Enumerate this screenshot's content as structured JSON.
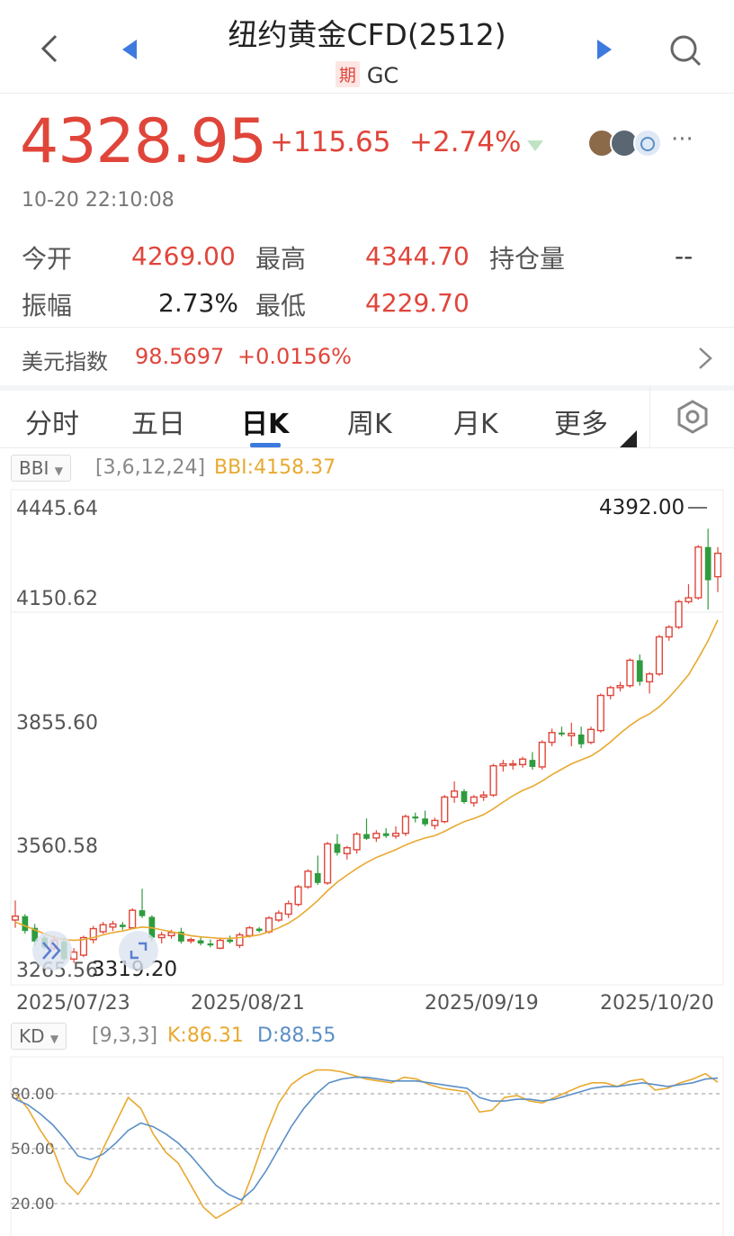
{
  "header": {
    "title": "纽约黄金CFD(2512)",
    "badge": "期",
    "code": "GC"
  },
  "quote": {
    "price": "4328.95",
    "change": "+115.65",
    "change_pct": "+2.74%",
    "timestamp": "10-20 22:10:08",
    "stats": {
      "open_label": "今开",
      "open": "4269.00",
      "high_label": "最高",
      "high": "4344.70",
      "oi_label": "持仓量",
      "oi": "--",
      "amp_label": "振幅",
      "amp": "2.73%",
      "low_label": "最低",
      "low": "4229.70"
    },
    "more_dots": "···"
  },
  "usd_index": {
    "label": "美元指数",
    "value": "98.5697",
    "change": "+0.0156%"
  },
  "tabs": [
    "分时",
    "五日",
    "日K",
    "周K",
    "月K",
    "更多"
  ],
  "active_tab": "日K",
  "colors": {
    "up": "#e0453a",
    "down": "#2e9b3e",
    "bbi": "#e8a930",
    "d_line": "#5b8fc7",
    "accent": "#3d7ae0"
  },
  "main_indicator": {
    "name": "BBI",
    "params": "[3,6,12,24]",
    "value_text": "BBI:4158.37"
  },
  "kd_indicator": {
    "name": "KD",
    "params": "[9,3,3]",
    "k_text": "K:86.31",
    "d_text": "D:88.55"
  },
  "chart_data": [
    {
      "type": "candlestick",
      "y_ticks": [
        "4445.64",
        "4150.62",
        "3855.60",
        "3560.58",
        "3265.56"
      ],
      "ylim": [
        3265.56,
        4445.64
      ],
      "x_ticks": [
        "2025/07/23",
        "2025/08/21",
        "2025/09/19",
        "2025/10/20"
      ],
      "high_marker": "4392.00",
      "low_marker": "3319.20",
      "candles": [
        {
          "o": 3390,
          "h": 3440,
          "l": 3370,
          "c": 3400
        },
        {
          "o": 3400,
          "h": 3405,
          "l": 3355,
          "c": 3362
        },
        {
          "o": 3370,
          "h": 3380,
          "l": 3325,
          "c": 3335
        },
        {
          "o": 3345,
          "h": 3350,
          "l": 3315,
          "c": 3320
        },
        {
          "o": 3318,
          "h": 3350,
          "l": 3312,
          "c": 3338
        },
        {
          "o": 3335,
          "h": 3345,
          "l": 3285,
          "c": 3290
        },
        {
          "o": 3290,
          "h": 3318,
          "l": 3280,
          "c": 3308
        },
        {
          "o": 3300,
          "h": 3350,
          "l": 3295,
          "c": 3345
        },
        {
          "o": 3340,
          "h": 3375,
          "l": 3330,
          "c": 3368
        },
        {
          "o": 3360,
          "h": 3385,
          "l": 3355,
          "c": 3378
        },
        {
          "o": 3372,
          "h": 3388,
          "l": 3362,
          "c": 3380
        },
        {
          "o": 3378,
          "h": 3385,
          "l": 3365,
          "c": 3372
        },
        {
          "o": 3370,
          "h": 3420,
          "l": 3368,
          "c": 3415
        },
        {
          "o": 3415,
          "h": 3470,
          "l": 3395,
          "c": 3400
        },
        {
          "o": 3398,
          "h": 3402,
          "l": 3335,
          "c": 3345
        },
        {
          "o": 3345,
          "h": 3360,
          "l": 3330,
          "c": 3352
        },
        {
          "o": 3350,
          "h": 3365,
          "l": 3342,
          "c": 3358
        },
        {
          "o": 3360,
          "h": 3370,
          "l": 3330,
          "c": 3335
        },
        {
          "o": 3338,
          "h": 3345,
          "l": 3330,
          "c": 3340
        },
        {
          "o": 3338,
          "h": 3345,
          "l": 3325,
          "c": 3330
        },
        {
          "o": 3330,
          "h": 3340,
          "l": 3320,
          "c": 3325
        },
        {
          "o": 3318,
          "h": 3345,
          "l": 3315,
          "c": 3338
        },
        {
          "o": 3340,
          "h": 3350,
          "l": 3330,
          "c": 3334
        },
        {
          "o": 3325,
          "h": 3358,
          "l": 3318,
          "c": 3352
        },
        {
          "o": 3350,
          "h": 3375,
          "l": 3345,
          "c": 3370
        },
        {
          "o": 3368,
          "h": 3372,
          "l": 3358,
          "c": 3362
        },
        {
          "o": 3360,
          "h": 3400,
          "l": 3355,
          "c": 3395
        },
        {
          "o": 3390,
          "h": 3415,
          "l": 3385,
          "c": 3408
        },
        {
          "o": 3405,
          "h": 3440,
          "l": 3395,
          "c": 3432
        },
        {
          "o": 3430,
          "h": 3480,
          "l": 3425,
          "c": 3475
        },
        {
          "o": 3475,
          "h": 3520,
          "l": 3470,
          "c": 3515
        },
        {
          "o": 3510,
          "h": 3555,
          "l": 3480,
          "c": 3485
        },
        {
          "o": 3485,
          "h": 3590,
          "l": 3480,
          "c": 3585
        },
        {
          "o": 3585,
          "h": 3610,
          "l": 3555,
          "c": 3562
        },
        {
          "o": 3560,
          "h": 3580,
          "l": 3545,
          "c": 3575
        },
        {
          "o": 3570,
          "h": 3615,
          "l": 3560,
          "c": 3610
        },
        {
          "o": 3610,
          "h": 3650,
          "l": 3595,
          "c": 3598
        },
        {
          "o": 3600,
          "h": 3620,
          "l": 3590,
          "c": 3612
        },
        {
          "o": 3612,
          "h": 3625,
          "l": 3600,
          "c": 3605
        },
        {
          "o": 3605,
          "h": 3630,
          "l": 3598,
          "c": 3612
        },
        {
          "o": 3612,
          "h": 3660,
          "l": 3605,
          "c": 3655
        },
        {
          "o": 3655,
          "h": 3665,
          "l": 3640,
          "c": 3650
        },
        {
          "o": 3650,
          "h": 3670,
          "l": 3630,
          "c": 3635
        },
        {
          "o": 3632,
          "h": 3652,
          "l": 3622,
          "c": 3645
        },
        {
          "o": 3642,
          "h": 3710,
          "l": 3638,
          "c": 3705
        },
        {
          "o": 3705,
          "h": 3745,
          "l": 3690,
          "c": 3720
        },
        {
          "o": 3720,
          "h": 3725,
          "l": 3688,
          "c": 3692
        },
        {
          "o": 3690,
          "h": 3710,
          "l": 3680,
          "c": 3705
        },
        {
          "o": 3705,
          "h": 3720,
          "l": 3695,
          "c": 3710
        },
        {
          "o": 3710,
          "h": 3790,
          "l": 3705,
          "c": 3785
        },
        {
          "o": 3785,
          "h": 3800,
          "l": 3770,
          "c": 3790
        },
        {
          "o": 3790,
          "h": 3800,
          "l": 3775,
          "c": 3790
        },
        {
          "o": 3788,
          "h": 3808,
          "l": 3780,
          "c": 3802
        },
        {
          "o": 3800,
          "h": 3820,
          "l": 3775,
          "c": 3782
        },
        {
          "o": 3782,
          "h": 3850,
          "l": 3775,
          "c": 3845
        },
        {
          "o": 3845,
          "h": 3880,
          "l": 3835,
          "c": 3870
        },
        {
          "o": 3870,
          "h": 3885,
          "l": 3860,
          "c": 3865
        },
        {
          "o": 3862,
          "h": 3895,
          "l": 3835,
          "c": 3868
        },
        {
          "o": 3865,
          "h": 3885,
          "l": 3830,
          "c": 3840
        },
        {
          "o": 3845,
          "h": 3885,
          "l": 3840,
          "c": 3878
        },
        {
          "o": 3875,
          "h": 3970,
          "l": 3870,
          "c": 3965
        },
        {
          "o": 3965,
          "h": 3990,
          "l": 3955,
          "c": 3985
        },
        {
          "o": 3985,
          "h": 4000,
          "l": 3975,
          "c": 3990
        },
        {
          "o": 3990,
          "h": 4060,
          "l": 3985,
          "c": 4055
        },
        {
          "o": 4055,
          "h": 4070,
          "l": 3990,
          "c": 4000
        },
        {
          "o": 4000,
          "h": 4025,
          "l": 3970,
          "c": 4020
        },
        {
          "o": 4020,
          "h": 4120,
          "l": 4015,
          "c": 4115
        },
        {
          "o": 4115,
          "h": 4145,
          "l": 4105,
          "c": 4140
        },
        {
          "o": 4140,
          "h": 4210,
          "l": 4135,
          "c": 4205
        },
        {
          "o": 4205,
          "h": 4250,
          "l": 4200,
          "c": 4215
        },
        {
          "o": 4215,
          "h": 4350,
          "l": 4210,
          "c": 4345
        },
        {
          "o": 4345,
          "h": 4392,
          "l": 4185,
          "c": 4260
        },
        {
          "o": 4269,
          "h": 4344.7,
          "l": 4229.7,
          "c": 4328.95
        }
      ],
      "bbi": [
        3385,
        3375,
        3365,
        3355,
        3345,
        3340,
        3338,
        3340,
        3345,
        3352,
        3358,
        3362,
        3368,
        3372,
        3370,
        3365,
        3360,
        3355,
        3350,
        3347,
        3345,
        3343,
        3343,
        3345,
        3348,
        3352,
        3360,
        3370,
        3382,
        3398,
        3418,
        3440,
        3465,
        3487,
        3505,
        3522,
        3537,
        3550,
        3560,
        3570,
        3582,
        3592,
        3600,
        3606,
        3617,
        3630,
        3642,
        3650,
        3660,
        3675,
        3692,
        3708,
        3722,
        3732,
        3746,
        3762,
        3776,
        3790,
        3800,
        3810,
        3826,
        3846,
        3868,
        3888,
        3905,
        3918,
        3936,
        3960,
        3988,
        4018,
        4060,
        4105,
        4158.37
      ]
    },
    {
      "type": "line",
      "name": "KD",
      "y_ticks": [
        "80.00",
        "50.00",
        "20.00"
      ],
      "ylim": [
        10,
        100
      ],
      "series": [
        {
          "name": "K",
          "values": [
            80,
            72,
            60,
            50,
            32,
            25,
            35,
            50,
            64,
            78,
            72,
            58,
            48,
            42,
            30,
            18,
            12,
            16,
            20,
            38,
            58,
            75,
            85,
            90,
            93,
            93,
            92,
            90,
            88,
            87,
            86,
            89,
            88,
            85,
            83,
            82,
            81,
            70,
            71,
            78,
            79,
            76,
            75,
            78,
            81,
            84,
            86,
            86,
            84,
            87,
            88,
            82,
            83,
            86,
            88,
            91,
            86.31
          ]
        },
        {
          "name": "D",
          "values": [
            77,
            74,
            69,
            63,
            55,
            46,
            44,
            47,
            53,
            60,
            64,
            62,
            58,
            53,
            46,
            38,
            30,
            25,
            22,
            28,
            38,
            50,
            62,
            72,
            80,
            86,
            88,
            89,
            89,
            88,
            87,
            87,
            87,
            86,
            85,
            84,
            83,
            78,
            76,
            76,
            77,
            77,
            76,
            77,
            79,
            81,
            83,
            84,
            84,
            85,
            86,
            85,
            84,
            85,
            86,
            88,
            88.55
          ]
        }
      ]
    }
  ]
}
